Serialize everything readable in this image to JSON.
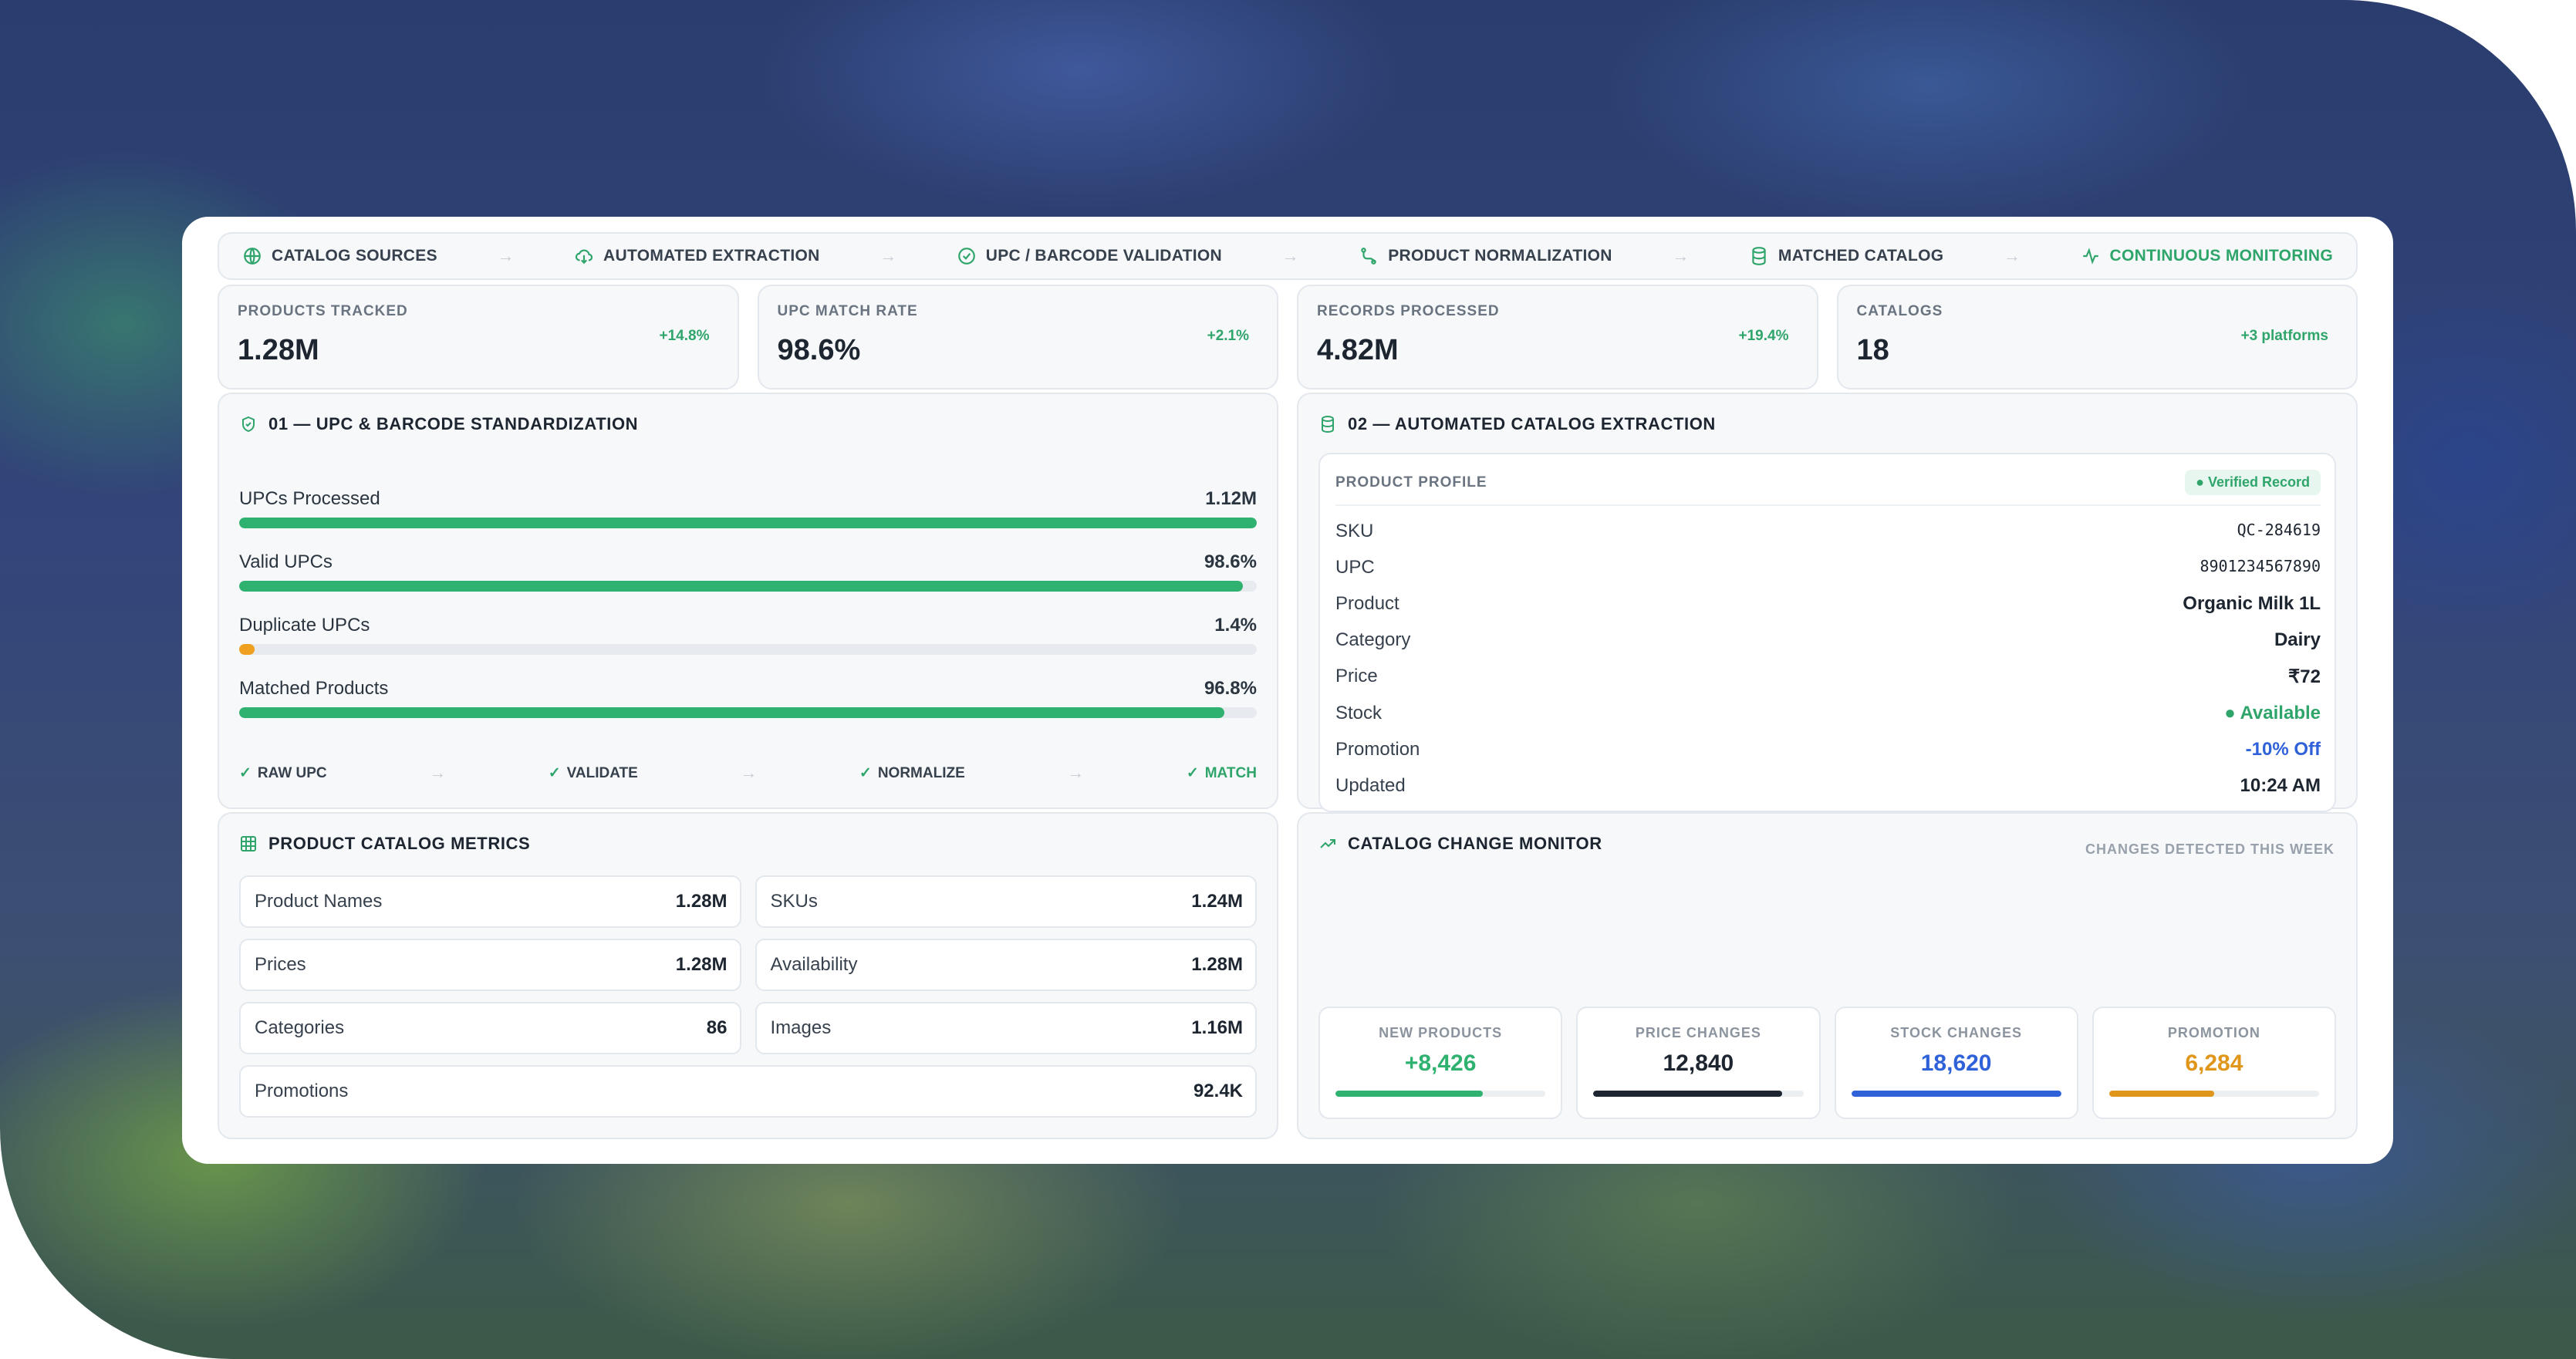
{
  "pipeline": [
    {
      "label": "CATALOG SOURCES",
      "icon": "globe-icon"
    },
    {
      "label": "AUTOMATED EXTRACTION",
      "icon": "cloud-download-icon"
    },
    {
      "label": "UPC / BARCODE VALIDATION",
      "icon": "check-circle-icon"
    },
    {
      "label": "PRODUCT NORMALIZATION",
      "icon": "route-icon"
    },
    {
      "label": "MATCHED CATALOG",
      "icon": "database-icon"
    },
    {
      "label": "CONTINUOUS MONITORING",
      "icon": "activity-icon"
    }
  ],
  "arrow": "→",
  "stats": [
    {
      "label": "PRODUCTS TRACKED",
      "value": "1.28M",
      "change": "+14.8%"
    },
    {
      "label": "UPC MATCH RATE",
      "value": "98.6%",
      "change": "+2.1%"
    },
    {
      "label": "RECORDS PROCESSED",
      "value": "4.82M",
      "change": "+19.4%"
    },
    {
      "label": "CATALOGS",
      "value": "18",
      "change": "+3 platforms"
    }
  ],
  "upc": {
    "title": "01 — UPC & BARCODE STANDARDIZATION",
    "bars": [
      {
        "label": "UPCs Processed",
        "value": "1.12M",
        "fill": 1.0,
        "color": "green"
      },
      {
        "label": "Valid UPCs",
        "value": "98.6%",
        "fill": 0.986,
        "color": "green"
      },
      {
        "label": "Duplicate UPCs",
        "value": "1.4%",
        "fill": 0.014,
        "color": "orange"
      },
      {
        "label": "Matched Products",
        "value": "96.8%",
        "fill": 0.968,
        "color": "green"
      }
    ],
    "flow": [
      "RAW UPC",
      "VALIDATE",
      "NORMALIZE",
      "MATCH"
    ],
    "check": "✓"
  },
  "extraction": {
    "title": "02 — AUTOMATED CATALOG EXTRACTION",
    "profile_title": "PRODUCT PROFILE",
    "badge": "● Verified Record",
    "fields": [
      {
        "k": "SKU",
        "v": "QC-284619",
        "style": "mono"
      },
      {
        "k": "UPC",
        "v": "8901234567890",
        "style": "mono"
      },
      {
        "k": "Product",
        "v": "Organic Milk 1L",
        "style": ""
      },
      {
        "k": "Category",
        "v": "Dairy",
        "style": ""
      },
      {
        "k": "Price",
        "v": "₹72",
        "style": ""
      },
      {
        "k": "Stock",
        "v": "● Available",
        "style": "green"
      },
      {
        "k": "Promotion",
        "v": "-10% Off",
        "style": "blue"
      },
      {
        "k": "Updated",
        "v": "10:24 AM",
        "style": ""
      }
    ]
  },
  "metrics": {
    "title": "PRODUCT CATALOG METRICS",
    "items": [
      {
        "k": "Product Names",
        "v": "1.28M"
      },
      {
        "k": "SKUs",
        "v": "1.24M"
      },
      {
        "k": "Prices",
        "v": "1.28M"
      },
      {
        "k": "Availability",
        "v": "1.28M"
      },
      {
        "k": "Categories",
        "v": "86"
      },
      {
        "k": "Images",
        "v": "1.16M"
      },
      {
        "k": "Promotions",
        "v": "92.4K"
      }
    ]
  },
  "monitor": {
    "title": "CATALOG CHANGE MONITOR",
    "subtitle": "CHANGES DETECTED THIS WEEK",
    "cards": [
      {
        "label": "NEW PRODUCTS",
        "value": "+8,426",
        "fill": 0.7,
        "color": "#2fb170"
      },
      {
        "label": "PRICE CHANGES",
        "value": "12,840",
        "fill": 0.9,
        "color": "#1d2530"
      },
      {
        "label": "STOCK CHANGES",
        "value": "18,620",
        "fill": 1.0,
        "color": "#2f62d8"
      },
      {
        "label": "PROMOTION",
        "value": "6,284",
        "fill": 0.5,
        "color": "#e0961a"
      }
    ]
  }
}
